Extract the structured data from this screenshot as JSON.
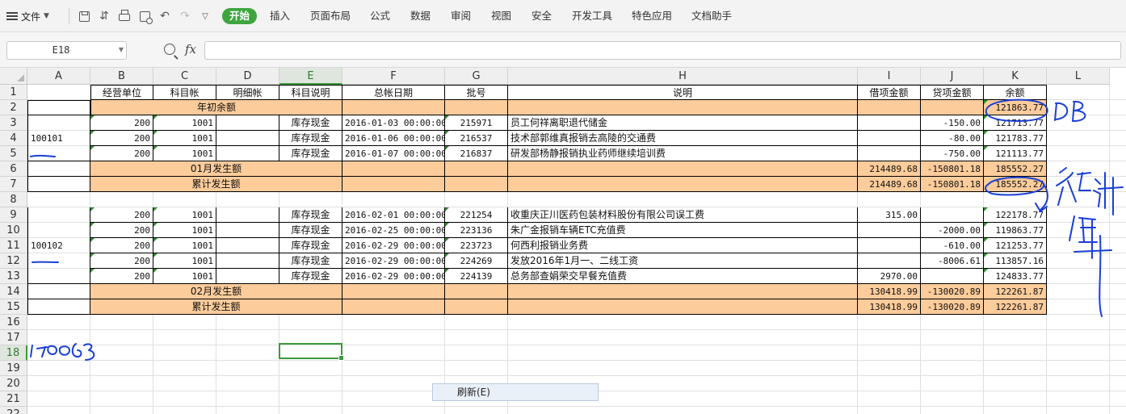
{
  "ribbon": {
    "file_label": "文件",
    "tabs": [
      "开始",
      "插入",
      "页面布局",
      "公式",
      "数据",
      "审阅",
      "视图",
      "安全",
      "开发工具",
      "特色应用",
      "文档助手"
    ],
    "active_tab": "开始",
    "accent_color": "#3fa53f"
  },
  "formula_bar": {
    "name_box": "E18",
    "fx_label": "fx",
    "content": ""
  },
  "sheet": {
    "columns": [
      "A",
      "B",
      "C",
      "D",
      "E",
      "F",
      "G",
      "H",
      "I",
      "J",
      "K",
      "L"
    ],
    "selected_column": "E",
    "row_numbers": [
      "1",
      "2",
      "3",
      "4",
      "5",
      "6",
      "7",
      "8",
      "9",
      "10",
      "11",
      "12",
      "13",
      "14",
      "15",
      "16",
      "17",
      "18",
      "19",
      "20",
      "21",
      "22"
    ],
    "selected_row": "18",
    "header_row": [
      "经营单位",
      "科目帐",
      "明细帐",
      "科目说明",
      "总帐日期",
      "批号",
      "说明",
      "借项金额",
      "贷项金额",
      "余额"
    ],
    "opening_balance": {
      "label": "年初余额",
      "balance": "121863.77"
    },
    "groups": [
      {
        "account": "100101",
        "rows": [
          {
            "unit": "200",
            "subject": "1001",
            "detail": "",
            "subject_desc": "库存现金",
            "date": "2016-01-03 00:00:00",
            "batch": "215971",
            "desc": "员工何祥离职退代储金",
            "debit": "",
            "credit": "-150.00",
            "balance": "121713.77"
          },
          {
            "unit": "200",
            "subject": "1001",
            "detail": "",
            "subject_desc": "库存现金",
            "date": "2016-01-06 00:00:00",
            "batch": "216537",
            "desc": "技术部郭维真报销去高陵的交通费",
            "debit": "",
            "credit": "-80.00",
            "balance": "121783.77"
          },
          {
            "unit": "200",
            "subject": "1001",
            "detail": "",
            "subject_desc": "库存现金",
            "date": "2016-01-07 00:00:00",
            "batch": "216837",
            "desc": "研发部杨静报销执业药师继续培训费",
            "debit": "",
            "credit": "-750.00",
            "balance": "121113.77"
          }
        ],
        "month_total": {
          "label": "01月发生额",
          "debit": "214489.68",
          "credit": "-150801.18",
          "balance": "185552.27"
        },
        "cumulative": {
          "label": "累计发生额",
          "debit": "214489.68",
          "credit": "-150801.18",
          "balance": "185552.27"
        }
      },
      {
        "account": "100102",
        "rows": [
          {
            "unit": "200",
            "subject": "1001",
            "detail": "",
            "subject_desc": "库存现金",
            "date": "2016-02-01 00:00:00",
            "batch": "221254",
            "desc": "收重庆正川医药包装材料股份有限公司误工费",
            "debit": "315.00",
            "credit": "",
            "balance": "122178.77"
          },
          {
            "unit": "200",
            "subject": "1001",
            "detail": "",
            "subject_desc": "库存现金",
            "date": "2016-02-25 00:00:00",
            "batch": "223136",
            "desc": "朱广金报销车辆ETC充值费",
            "debit": "",
            "credit": "-2000.00",
            "balance": "119863.77"
          },
          {
            "unit": "200",
            "subject": "1001",
            "detail": "",
            "subject_desc": "库存现金",
            "date": "2016-02-29 00:00:00",
            "batch": "223723",
            "desc": "何西利报销业务费",
            "debit": "",
            "credit": "-610.00",
            "balance": "121253.77"
          },
          {
            "unit": "200",
            "subject": "1001",
            "detail": "",
            "subject_desc": "库存现金",
            "date": "2016-02-29 00:00:00",
            "batch": "224269",
            "desc": "发放2016年1月一、二线工资",
            "debit": "",
            "credit": "-8006.61",
            "balance": "113857.16"
          },
          {
            "unit": "200",
            "subject": "1001",
            "detail": "",
            "subject_desc": "库存现金",
            "date": "2016-02-29 00:00:00",
            "batch": "224139",
            "desc": "总务部查娟荣交早餐充值费",
            "debit": "2970.00",
            "credit": "",
            "balance": "124833.77"
          }
        ],
        "month_total": {
          "label": "02月发生额",
          "debit": "130418.99",
          "credit": "-130020.89",
          "balance": "122261.87"
        },
        "cumulative": {
          "label": "累计发生额",
          "debit": "130418.99",
          "credit": "-130020.89",
          "balance": "122261.87"
        }
      }
    ],
    "summary_fill_color": "#fdcc9b",
    "handwriting_color": "#1a3fd6"
  },
  "context_button": {
    "label": "刷新(E)"
  }
}
